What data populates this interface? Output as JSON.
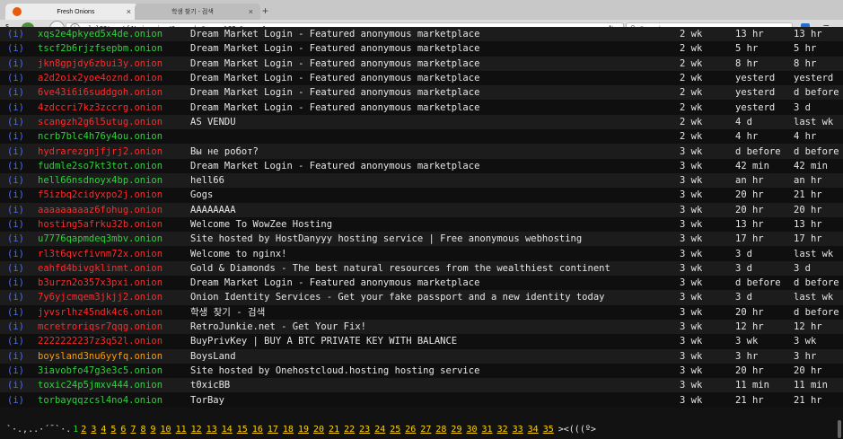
{
  "tabs": [
    {
      "label": "Fresh Onions",
      "active": true
    },
    {
      "label": "학생 찾기 - 검색",
      "active": false
    }
  ],
  "toolbar": {
    "sbutton": "S",
    "url": "zlal32teyptf4tvi.onion/?search=&rep=n%2Fa&page=1",
    "search_placeholder": "Search"
  },
  "rows": [
    {
      "addr": "xqs2e4pkyed5x4de.onion",
      "color": "green",
      "title": "Dream Market Login - Featured anonymous marketplace",
      "added": "2 wk",
      "first": "13 hr",
      "last": "13 hr"
    },
    {
      "addr": "tscf2b6rjzfsepbm.onion",
      "color": "green",
      "title": "Dream Market Login - Featured anonymous marketplace",
      "added": "2 wk",
      "first": "5 hr",
      "last": "5 hr"
    },
    {
      "addr": "jkn8gpjdy6zbui3y.onion",
      "color": "red",
      "title": "Dream Market Login - Featured anonymous marketplace",
      "added": "2 wk",
      "first": "8 hr",
      "last": "8 hr"
    },
    {
      "addr": "a2d2oix2yoe4oznd.onion",
      "color": "red",
      "title": "Dream Market Login - Featured anonymous marketplace",
      "added": "2 wk",
      "first": "yesterd",
      "last": "yesterd"
    },
    {
      "addr": "6ve43i6i6suddgoh.onion",
      "color": "red",
      "title": "Dream Market Login - Featured anonymous marketplace",
      "added": "2 wk",
      "first": "yesterd",
      "last": "d before"
    },
    {
      "addr": "4zdccri7kz3zccrg.onion",
      "color": "red",
      "title": "Dream Market Login - Featured anonymous marketplace",
      "added": "2 wk",
      "first": "yesterd",
      "last": "3 d"
    },
    {
      "addr": "scangzh2g6l5utug.onion",
      "color": "red",
      "title": "AS VENDU",
      "added": "2 wk",
      "first": "4 d",
      "last": "last wk"
    },
    {
      "addr": "ncrb7blc4h76y4ou.onion",
      "color": "green",
      "title": "",
      "added": "2 wk",
      "first": "4 hr",
      "last": "4 hr"
    },
    {
      "addr": "hydrarezgnjfjrj2.onion",
      "color": "red",
      "title": "Вы не робот?",
      "added": "3 wk",
      "first": "d before",
      "last": "d before"
    },
    {
      "addr": "fudmle2so7kt3tot.onion",
      "color": "green",
      "title": "Dream Market Login - Featured anonymous marketplace",
      "added": "3 wk",
      "first": "42 min",
      "last": "42 min"
    },
    {
      "addr": "hell66nsdnoyx4bp.onion",
      "color": "green",
      "title": "hell66",
      "added": "3 wk",
      "first": "an hr",
      "last": "an hr"
    },
    {
      "addr": "f5izbq2cidyxpo2j.onion",
      "color": "red",
      "title": "Gogs",
      "added": "3 wk",
      "first": "20 hr",
      "last": "21 hr"
    },
    {
      "addr": "aaaaaaaaaz6fohug.onion",
      "color": "red",
      "title": "AAAAAAAA",
      "added": "3 wk",
      "first": "20 hr",
      "last": "20 hr"
    },
    {
      "addr": "hosting5afrku32b.onion",
      "color": "red",
      "title": "Welcome To WowZee Hosting",
      "added": "3 wk",
      "first": "13 hr",
      "last": "13 hr"
    },
    {
      "addr": "u7776qapmdeq3mbv.onion",
      "color": "green",
      "title": "Site hosted by HostDanyyy hosting service | Free anonymous webhosting",
      "added": "3 wk",
      "first": "17 hr",
      "last": "17 hr"
    },
    {
      "addr": "rl3t6qvcfivnm72x.onion",
      "color": "red",
      "title": "Welcome to nginx!",
      "added": "3 wk",
      "first": "3 d",
      "last": "last wk"
    },
    {
      "addr": "eahfd4bivgklinmt.onion",
      "color": "red",
      "title": "Gold & Diamonds - The best natural resources from the wealthiest continent",
      "added": "3 wk",
      "first": "3 d",
      "last": "3 d"
    },
    {
      "addr": "b3urzn2o357x3pxi.onion",
      "color": "red",
      "title": "Dream Market Login - Featured anonymous marketplace",
      "added": "3 wk",
      "first": "d before",
      "last": "d before"
    },
    {
      "addr": "7y6yjcmqem3jkjj2.onion",
      "color": "red",
      "title": "Onion Identity Services - Get your fake passport and a new identity today",
      "added": "3 wk",
      "first": "3 d",
      "last": "last wk"
    },
    {
      "addr": "jyvsrlhz45ndk4c6.onion",
      "color": "red",
      "title": "학생 찾기 - 검색",
      "added": "3 wk",
      "first": "20 hr",
      "last": "d before"
    },
    {
      "addr": "mcretroriqsr7qqg.onion",
      "color": "red",
      "title": "RetroJunkie.net - Get Your Fix!",
      "added": "3 wk",
      "first": "12 hr",
      "last": "12 hr"
    },
    {
      "addr": "2222222237z3q52l.onion",
      "color": "red",
      "title": "BuyPrivKey | BUY A BTC PRIVATE KEY WITH BALANCE",
      "added": "3 wk",
      "first": "3 wk",
      "last": "3 wk"
    },
    {
      "addr": "boysland3nu6yyfq.onion",
      "color": "orange",
      "title": "BoysLand",
      "added": "3 wk",
      "first": "3 hr",
      "last": "3 hr"
    },
    {
      "addr": "3iavobfo47g3e3c5.onion",
      "color": "green",
      "title": "Site hosted by Onehostcloud.hosting hosting service",
      "added": "3 wk",
      "first": "20 hr",
      "last": "20 hr"
    },
    {
      "addr": "toxic24p5jmxv444.onion",
      "color": "green",
      "title": "t0xicBB",
      "added": "3 wk",
      "first": "11 min",
      "last": "11 min"
    },
    {
      "addr": "torbayqqzcsl4no4.onion",
      "color": "green",
      "title": "TorBay",
      "added": "3 wk",
      "first": "21 hr",
      "last": "21 hr"
    }
  ],
  "info_label": "(i)",
  "pagination": {
    "prefix": "`·.,..·´¯`·.",
    "current": "1",
    "pages": [
      "2",
      "3",
      "4",
      "5",
      "6",
      "7",
      "8",
      "9",
      "10",
      "11",
      "12",
      "13",
      "14",
      "15",
      "16",
      "17",
      "18",
      "19",
      "20",
      "21",
      "22",
      "23",
      "24",
      "25",
      "26",
      "27",
      "28",
      "29",
      "30",
      "31",
      "32",
      "33",
      "34",
      "35"
    ],
    "suffix": "><(((º>"
  },
  "colors": {
    "green": "#2fd13a",
    "red": "#ff2a2a",
    "orange": "#ff9a00",
    "page_link": "#ffd200",
    "info": "#4a6cff"
  }
}
